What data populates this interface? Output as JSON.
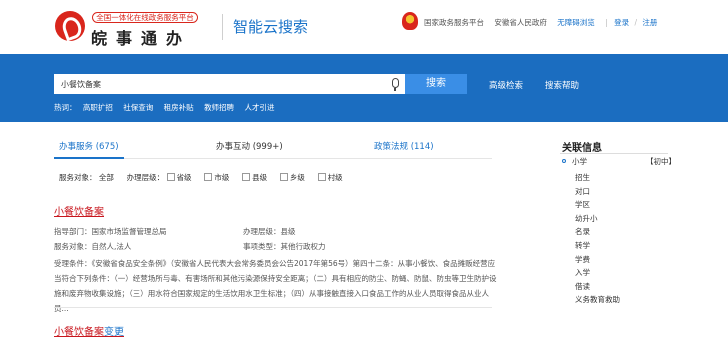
{
  "header": {
    "logo_small": "全国一体化在线政务服务平台",
    "logo_big": "皖事通办",
    "subtitle": "智能云搜索",
    "links": [
      "国家政务服务平台",
      "安徽省人民政府",
      "无障碍浏览"
    ],
    "login": "登录",
    "register": "注册",
    "separator": "/"
  },
  "search": {
    "value": "小餐饮备案",
    "button": "搜索",
    "advanced": "高级检索",
    "help": "搜索帮助",
    "hot_label": "热词：",
    "hot_words": [
      "高职扩招",
      "社保查询",
      "租房补贴",
      "教师招聘",
      "人才引进"
    ]
  },
  "tabs": [
    {
      "label": "办事服务 (675)"
    },
    {
      "label": "办事互动 (999+)"
    },
    {
      "label": "政策法规 (114)"
    }
  ],
  "filters": {
    "object_label": "服务对象：",
    "object_value": "全部",
    "level_label": "办理层级：",
    "levels": [
      "省级",
      "市级",
      "县级",
      "乡级",
      "村级"
    ]
  },
  "results": [
    {
      "title": "小餐饮备案",
      "dept_label": "指导部门：国家市场监督管理总局",
      "level_label": "办理层级：县级",
      "object_label": "服务对象：自然人,法人",
      "type_label": "事项类型：其他行政权力",
      "conditions": "受理条件：《安徽省食品安全条例》（安徽省人民代表大会常务委员会公告2017年第56号）第四十二条：从事小餐饮、食品摊贩经营应当符合下列条件：（一）经营场所与毒、有害场所和其他污染源保持安全距离；（二）具有相应的防尘、防蝇、防鼠、防虫等卫生防护设施和废弃物收集设施；（三）用水符合国家规定的生活饮用水卫生标准；（四）从事接触直接入口食品工作的从业人员取得食品从业人员..."
    },
    {
      "title": "小餐饮备案",
      "title_tail": "变更"
    }
  ],
  "sidebar": {
    "title": "关联信息",
    "head": "小学",
    "tag": "【初中】",
    "items": [
      "招生",
      "对口",
      "学区",
      "幼升小",
      "名录",
      "转学",
      "学费",
      "入学",
      "借读",
      "义务教育救助"
    ]
  }
}
